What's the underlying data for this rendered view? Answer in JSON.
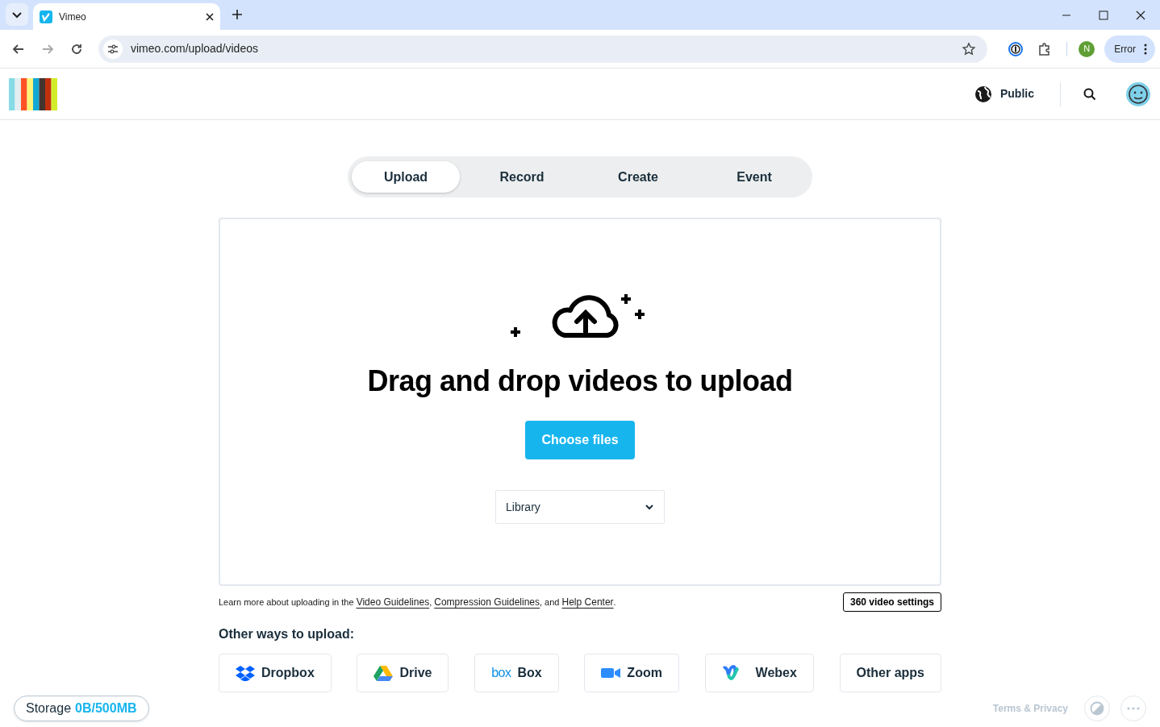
{
  "browser": {
    "tab_title": "Vimeo",
    "url": "vimeo.com/upload/videos",
    "profile_initial": "N",
    "error_label": "Error"
  },
  "header": {
    "visibility": "Public"
  },
  "tabs": [
    {
      "label": "Upload",
      "selected": true
    },
    {
      "label": "Record",
      "selected": false
    },
    {
      "label": "Create",
      "selected": false
    },
    {
      "label": "Event",
      "selected": false
    }
  ],
  "upload": {
    "title": "Drag and drop videos to upload",
    "button": "Choose files",
    "destination": "Library"
  },
  "help": [
    {
      "kind": "plain",
      "text": "Learn more about uploading in the "
    },
    {
      "kind": "link",
      "text": "Video Guidelines"
    },
    {
      "kind": "plain",
      "text": ", "
    },
    {
      "kind": "link",
      "text": "Compression Guidelines"
    },
    {
      "kind": "plain",
      "text": ", and "
    },
    {
      "kind": "link",
      "text": "Help Center"
    },
    {
      "kind": "plain",
      "text": "."
    }
  ],
  "settings_button": "360 video settings",
  "other_ways": {
    "title": "Other ways to upload:",
    "apps": [
      {
        "kind": "dropbox",
        "label": "Dropbox"
      },
      {
        "kind": "drive",
        "label": "Drive"
      },
      {
        "kind": "box",
        "logo_text": "box",
        "label": "Box"
      },
      {
        "kind": "zoom",
        "label": "Zoom"
      },
      {
        "kind": "webex",
        "label": "Webex"
      },
      {
        "kind": "other",
        "label": "Other apps"
      }
    ]
  },
  "storage": {
    "label": "Storage",
    "value": "0B/500MB"
  },
  "footer": {
    "terms": "Terms & Privacy"
  }
}
